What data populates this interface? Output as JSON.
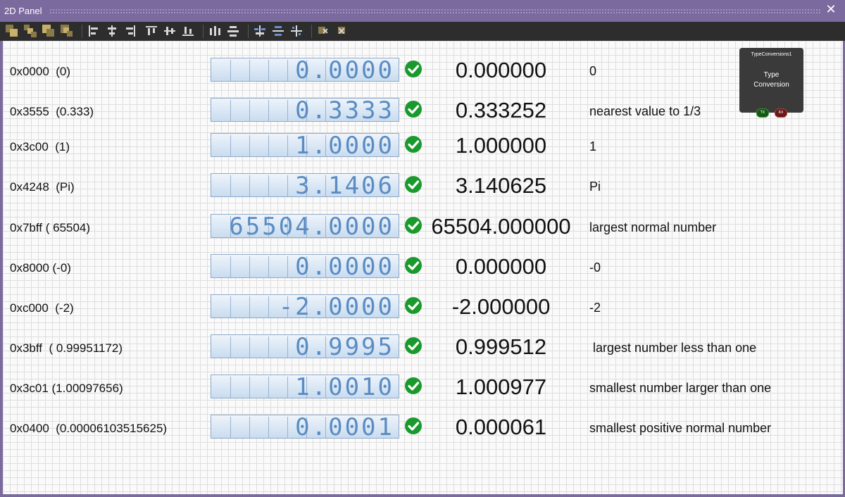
{
  "window": {
    "title": "2D Panel",
    "close_label": "✕"
  },
  "toolbar": {
    "icons": [
      "bring-forward-icon",
      "bring-to-front-icon",
      "send-backward-icon",
      "send-to-back-icon",
      "align-left-icon",
      "align-center-icon",
      "align-right-icon",
      "align-top-icon",
      "align-middle-icon",
      "align-bottom-icon",
      "distribute-horizontal-icon",
      "distribute-vertical-icon",
      "make-same-width-icon",
      "make-same-height-icon",
      "make-same-size-icon",
      "lock-icon",
      "unlock-icon"
    ]
  },
  "block": {
    "name": "TypeConversions1",
    "type_line1": "Type",
    "type_line2": "Conversion",
    "tx": "TX",
    "rx": "RX"
  },
  "rows": [
    {
      "hex": "0x0000  (0)",
      "lcd": "0.0000",
      "decimal": "0.000000",
      "note": "0"
    },
    {
      "hex": "0x3555  (0.333)",
      "lcd": "0.3333",
      "decimal": "0.333252",
      "note": "nearest value to 1/3"
    },
    {
      "hex": "0x3c00  (1)",
      "lcd": "1.0000",
      "decimal": "1.000000",
      "note": "1"
    },
    {
      "hex": "0x4248  (Pi)",
      "lcd": "3.1406",
      "decimal": "3.140625",
      "note": "Pi"
    },
    {
      "hex": "0x7bff ( 65504)",
      "lcd": "65504.0000",
      "decimal": "65504.000000",
      "note": "largest normal number"
    },
    {
      "hex": "0x8000 (-0)",
      "lcd": "0.0000",
      "decimal": "0.000000",
      "note": "-0"
    },
    {
      "hex": "0xc000  (-2)",
      "lcd": "-2.0000",
      "decimal": "-2.000000",
      "note": "-2"
    },
    {
      "hex": "0x3bff  ( 0.99951172)",
      "lcd": "0.9995",
      "decimal": "0.999512",
      "note": " largest number less than one"
    },
    {
      "hex": "0x3c01 (1.00097656)",
      "lcd": "1.0010",
      "decimal": "1.000977",
      "note": "smallest number larger than one"
    },
    {
      "hex": "0x0400  (0.00006103515625)",
      "lcd": "0.0001",
      "decimal": "0.000061",
      "note": "smallest positive normal number"
    }
  ]
}
